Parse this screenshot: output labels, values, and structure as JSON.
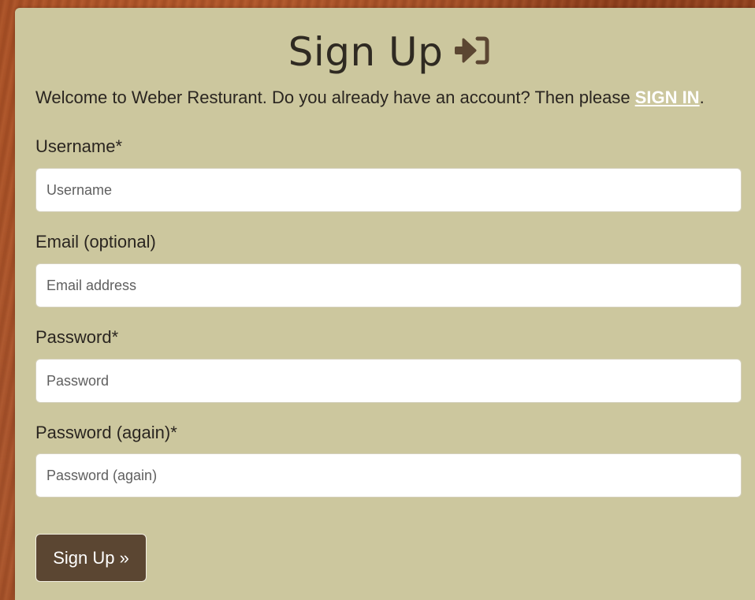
{
  "form": {
    "title": "Sign Up",
    "intro_text": "Welcome to Weber Resturant. Do you already have an account? Then please ",
    "signin_link": "SIGN IN",
    "intro_end": ".",
    "fields": [
      {
        "label": "Username*",
        "placeholder": "Username"
      },
      {
        "label": "Email (optional)",
        "placeholder": "Email address"
      },
      {
        "label": "Password*",
        "placeholder": "Password"
      },
      {
        "label": "Password (again)*",
        "placeholder": "Password (again)"
      }
    ],
    "submit_label": "Sign Up »"
  },
  "icons": {
    "title_icon": "sign-in-icon"
  },
  "colors": {
    "card_background": "#ccc79e",
    "button_background": "#5b4632",
    "icon_color": "#5b4632",
    "link_color": "#ffffff"
  }
}
